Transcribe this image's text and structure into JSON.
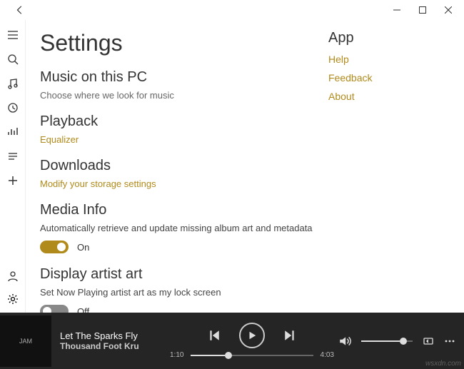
{
  "window": {
    "back": "←"
  },
  "page_title": "Settings",
  "sections": {
    "music": {
      "title": "Music on this PC",
      "subtitle": "Choose where we look for music"
    },
    "playback": {
      "title": "Playback",
      "link": "Equalizer"
    },
    "downloads": {
      "title": "Downloads",
      "link": "Modify your storage settings"
    },
    "mediainfo": {
      "title": "Media Info",
      "desc": "Automatically retrieve and update missing album art and metadata",
      "toggle_label": "On",
      "toggle_on": true
    },
    "artistart": {
      "title": "Display artist art",
      "desc": "Set Now Playing artist art as my lock screen",
      "toggle_label": "Off",
      "toggle_on": false
    }
  },
  "app_section": {
    "title": "App",
    "links": {
      "help": "Help",
      "feedback": "Feedback",
      "about": "About"
    }
  },
  "player": {
    "album_text": "JAM",
    "track_title": "Let The Sparks Fly",
    "track_artist": "Thousand Foot Kru",
    "elapsed": "1:10",
    "total": "4:03"
  },
  "watermark": "wsxdn.com"
}
